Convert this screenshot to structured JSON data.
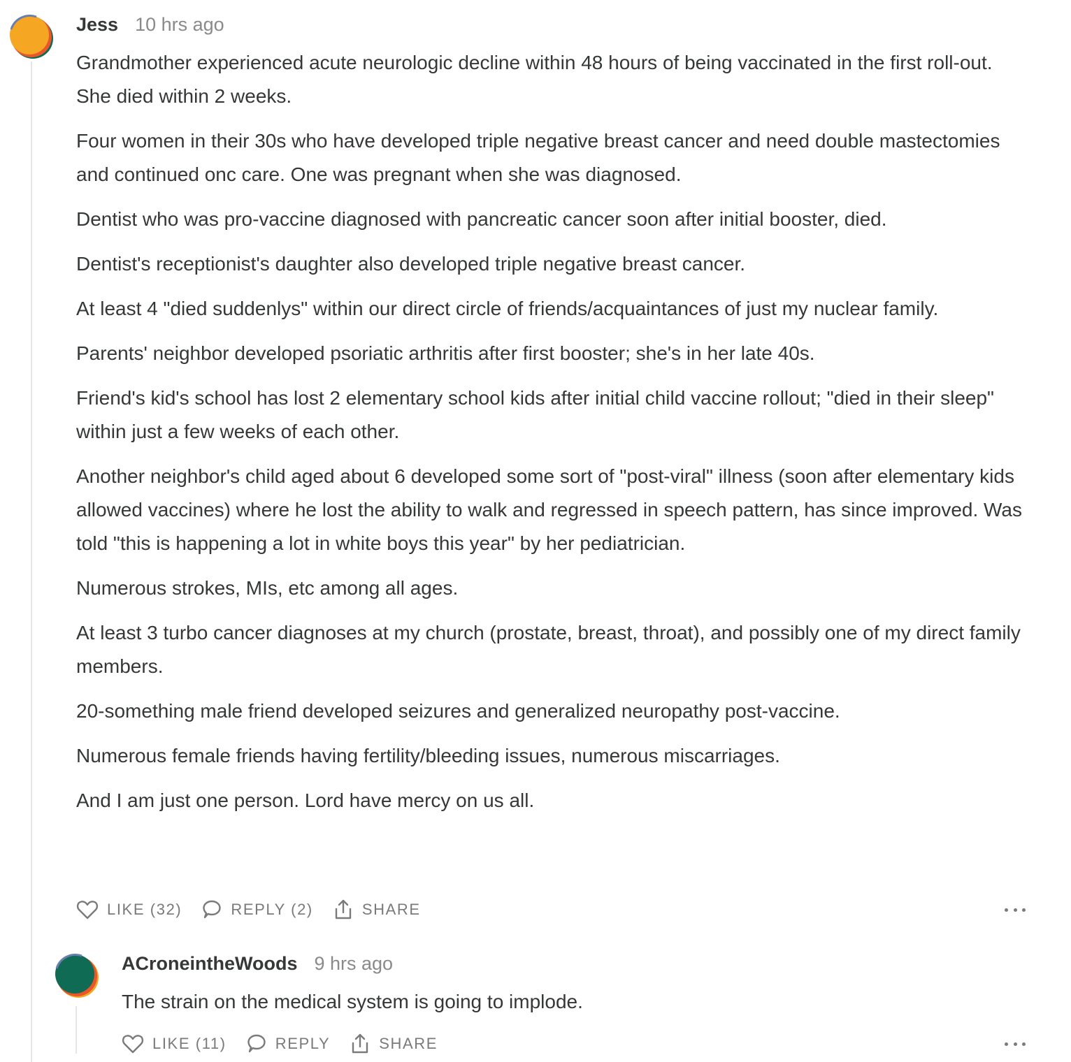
{
  "comment": {
    "author": "Jess",
    "timestamp": "10 hrs ago",
    "paragraphs": [
      "Grandmother experienced acute neurologic decline within 48 hours of being vaccinated in the first roll-out. She died within 2 weeks.",
      "Four women in their 30s who have developed triple negative breast cancer and need double mastectomies and continued onc care. One was pregnant when she was diagnosed.",
      "Dentist who was pro-vaccine diagnosed with pancreatic cancer soon after initial booster, died.",
      "Dentist's receptionist's daughter also developed triple negative breast cancer.",
      "At least 4 \"died suddenlys\" within our direct circle of friends/acquaintances of just my nuclear family.",
      "Parents' neighbor developed psoriatic arthritis after first booster; she's in her late 40s.",
      "Friend's kid's school has lost 2 elementary school kids after initial child vaccine rollout; \"died in their sleep\" within just a few weeks of each other.",
      "Another neighbor's child aged about 6 developed some sort of \"post-viral\" illness (soon after elementary kids allowed vaccines) where he lost the ability to walk and regressed in speech pattern, has since improved. Was told \"this is happening a lot in white boys this year\" by her pediatrician.",
      "Numerous strokes, MIs, etc among all ages.",
      "At least 3 turbo cancer diagnoses at my church (prostate, breast, throat), and possibly one of my direct family members.",
      "20-something male friend developed seizures and generalized neuropathy post-vaccine.",
      "Numerous female friends having fertility/bleeding issues, numerous miscarriages.",
      "And I am just one person. Lord have mercy on us all."
    ],
    "actions": {
      "like": "LIKE (32)",
      "reply": "REPLY (2)",
      "share": "SHARE"
    },
    "avatar_colors": [
      "#f5a623",
      "#e8562a",
      "#0f6b53"
    ]
  },
  "reply": {
    "author": "ACroneintheWoods",
    "timestamp": "9 hrs ago",
    "text": "The strain on the medical system is going to implode.",
    "actions": {
      "like": "LIKE (11)",
      "reply": "REPLY",
      "share": "SHARE"
    },
    "avatar_colors": [
      "#0f6b53",
      "#e8562a",
      "#f5a623"
    ]
  },
  "icons": {
    "like": "heart-icon",
    "reply": "speech-bubble-icon",
    "share": "share-icon",
    "more": "ellipsis-icon"
  }
}
